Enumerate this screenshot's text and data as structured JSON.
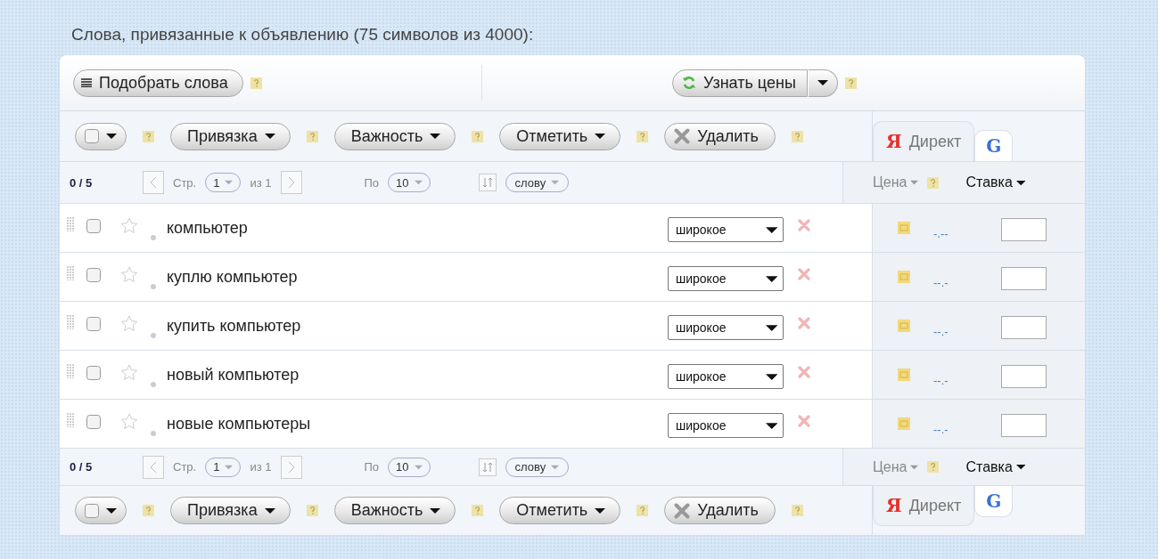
{
  "title": "Слова, привязанные к объявлению (75 символов из 4000):",
  "top_toolbar": {
    "pick_words": "Подобрать слова",
    "get_prices": "Узнать цены"
  },
  "action_bars": [
    {
      "select_all_checked": false,
      "buttons": [
        {
          "kind": "dropdown",
          "label": "Привязка"
        },
        {
          "kind": "dropdown",
          "label": "Важность"
        },
        {
          "kind": "dropdown",
          "label": "Отметить"
        },
        {
          "kind": "delete",
          "label": "Удалить"
        }
      ],
      "tabs": [
        {
          "kind": "yandex",
          "logo": "Я",
          "label": "Директ",
          "selected": true
        },
        {
          "kind": "google",
          "logo": "G",
          "selected": false
        }
      ]
    },
    {
      "select_all_checked": false,
      "buttons": [
        {
          "kind": "dropdown",
          "label": "Привязка"
        },
        {
          "kind": "dropdown",
          "label": "Важность"
        },
        {
          "kind": "dropdown",
          "label": "Отметить"
        },
        {
          "kind": "delete",
          "label": "Удалить"
        }
      ],
      "tabs": [
        {
          "kind": "yandex",
          "logo": "Я",
          "label": "Директ",
          "selected": true
        },
        {
          "kind": "google",
          "logo": "G",
          "selected": false
        }
      ]
    }
  ],
  "pagers": [
    {
      "selection": "0 / 5",
      "page_label": "Стр.",
      "page": "1",
      "page_of": "из 1",
      "per_page_label": "По",
      "per_page": "10",
      "sort_by": "слову",
      "price_header": "Цена",
      "bid_header": "Ставка"
    },
    {
      "selection": "0 / 5",
      "page_label": "Стр.",
      "page": "1",
      "page_of": "из 1",
      "per_page_label": "По",
      "per_page": "10",
      "sort_by": "слову",
      "price_header": "Цена",
      "bid_header": "Ставка"
    }
  ],
  "rows": [
    {
      "phrase": "компьютер",
      "checked": false,
      "starred": false,
      "match": "широкое",
      "price": "-.--"
    },
    {
      "phrase": "куплю компьютер",
      "checked": false,
      "starred": false,
      "match": "широкое",
      "price": "--.-"
    },
    {
      "phrase": "купить компьютер",
      "checked": false,
      "starred": false,
      "match": "широкое",
      "price": "--.-"
    },
    {
      "phrase": "новый компьютер",
      "checked": false,
      "starred": false,
      "match": "широкое",
      "price": "--.-"
    },
    {
      "phrase": "новые компьютеры",
      "checked": false,
      "starred": false,
      "match": "широкое",
      "price": "--.-"
    }
  ]
}
